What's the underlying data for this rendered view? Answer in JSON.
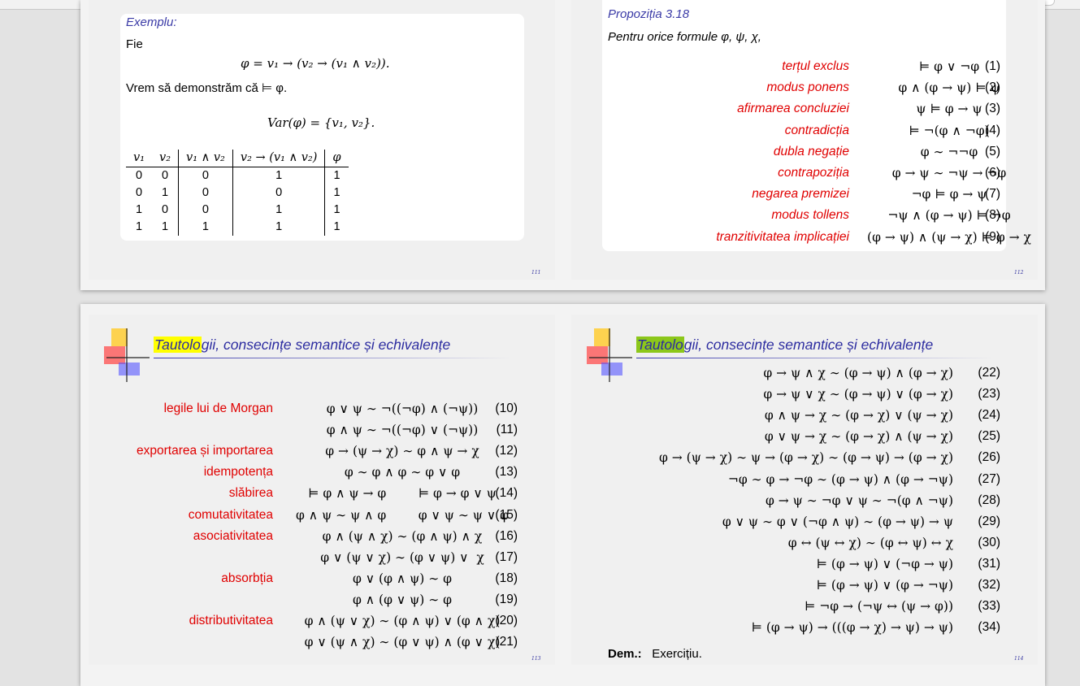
{
  "slide111": {
    "page": "111",
    "block_title": "Exemplu:",
    "fie": "Fie",
    "formula": "φ = v₁ → (v₂ → (v₁ ∧ v₂)).",
    "vrem": "Vrem să demonstrăm că ⊨ φ.",
    "var": "Var(φ) = {v₁, v₂}.",
    "table": {
      "headers": [
        "v₁",
        "v₂",
        "v₁ ∧ v₂",
        "v₂ → (v₁ ∧ v₂)",
        "φ"
      ],
      "rows": [
        [
          "0",
          "0",
          "0",
          "1",
          "1"
        ],
        [
          "0",
          "1",
          "0",
          "0",
          "1"
        ],
        [
          "1",
          "0",
          "0",
          "1",
          "1"
        ],
        [
          "1",
          "1",
          "1",
          "1",
          "1"
        ]
      ]
    }
  },
  "slide112": {
    "page": "112",
    "title": "Propoziția 3.18",
    "intro": "Pentru orice formule φ, ψ, χ,",
    "rows": [
      {
        "label": "terțul exclus",
        "formula": "⊨ φ ∨ ¬φ",
        "num": "(1)"
      },
      {
        "label": "modus ponens",
        "formula": "φ ∧ (φ → ψ) ⊨ ψ",
        "num": "(2)"
      },
      {
        "label": "afirmarea concluziei",
        "formula": "ψ ⊨ φ → ψ",
        "num": "(3)"
      },
      {
        "label": "contradicția",
        "formula": "⊨ ¬(φ ∧ ¬φ)",
        "num": "(4)"
      },
      {
        "label": "dubla negație",
        "formula": "φ ∼ ¬¬φ",
        "num": "(5)"
      },
      {
        "label": "contrapoziția",
        "formula": "φ → ψ ∼ ¬ψ → ¬φ",
        "num": "(6)"
      },
      {
        "label": "negarea premizei",
        "formula": "¬φ ⊨ φ → ψ",
        "num": "(7)"
      },
      {
        "label": "modus tollens",
        "formula": "¬ψ ∧ (φ → ψ) ⊨ ¬φ",
        "num": "(8)"
      },
      {
        "label": "tranzitivitatea implicației",
        "formula": "(φ → ψ) ∧ (ψ → χ) ⊨ φ → χ",
        "num": "(9)"
      }
    ]
  },
  "slide113": {
    "page": "113",
    "title_highlight": "Tautolo",
    "title_rest": "gii, consecințe semantice și echivalențe",
    "highlight_color": "#ffff00",
    "rows": [
      {
        "label": "legile lui de Morgan",
        "formula": "φ ∨ ψ ∼ ¬((¬φ) ∧ (¬ψ))",
        "num": "(10)"
      },
      {
        "label": "",
        "formula": "φ ∧ ψ ∼ ¬((¬φ) ∨ (¬ψ))",
        "num": "(11)"
      },
      {
        "label": "exportarea și importarea",
        "formula": "φ → (ψ → χ) ∼ φ ∧ ψ → χ",
        "num": "(12)"
      },
      {
        "label": "idempotența",
        "formula": "φ ∼ φ ∧ φ ∼ φ ∨ φ",
        "num": "(13)"
      },
      {
        "label": "slăbirea",
        "formula": "⊨ φ ∧ ψ → φ        ⊨ φ → φ ∨ ψ",
        "num": "(14)"
      },
      {
        "label": "comutativitatea",
        "formula": "φ ∧ ψ ∼ ψ ∧ φ        φ ∨ ψ ∼ ψ ∨ φ",
        "num": "(15)"
      },
      {
        "label": "asociativitatea",
        "formula": "φ ∧ (ψ ∧ χ) ∼ (φ ∧ ψ) ∧ χ",
        "num": "(16)"
      },
      {
        "label": "",
        "formula": "φ ∨ (ψ ∨ χ) ∼ (φ ∨ ψ) ∨  χ",
        "num": "(17)"
      },
      {
        "label": "absorbția",
        "formula": "φ ∨ (φ ∧ ψ) ∼ φ",
        "num": "(18)"
      },
      {
        "label": "",
        "formula": "φ ∧ (φ ∨ ψ) ∼ φ",
        "num": "(19)"
      },
      {
        "label": "distributivitatea",
        "formula": "φ ∧ (ψ ∨ χ) ∼ (φ ∧ ψ) ∨ (φ ∧ χ)",
        "num": "(20)"
      },
      {
        "label": "",
        "formula": "φ ∨ (ψ ∧ χ) ∼ (φ ∨ ψ) ∧ (φ ∨ χ)",
        "num": "(21)"
      }
    ]
  },
  "slide114": {
    "page": "114",
    "title_highlight": "Tautolo",
    "title_rest": "gii, consecințe semantice și echivalențe",
    "highlight_color": "#8cc71a",
    "rows": [
      {
        "formula": "φ → ψ ∧ χ ∼ (φ → ψ) ∧ (φ → χ)",
        "num": "(22)"
      },
      {
        "formula": "φ → ψ ∨ χ ∼ (φ → ψ) ∨ (φ → χ)",
        "num": "(23)"
      },
      {
        "formula": "φ ∧ ψ → χ ∼ (φ → χ) ∨ (ψ → χ)",
        "num": "(24)"
      },
      {
        "formula": "φ ∨ ψ → χ ∼ (φ → χ) ∧ (ψ → χ)",
        "num": "(25)"
      },
      {
        "formula": "φ → (ψ → χ) ∼ ψ → (φ → χ) ∼ (φ → ψ) → (φ → χ)",
        "num": "(26)"
      },
      {
        "formula": "¬φ ∼ φ → ¬φ ∼ (φ → ψ) ∧ (φ → ¬ψ)",
        "num": "(27)"
      },
      {
        "formula": "φ → ψ ∼ ¬φ ∨ ψ ∼ ¬(φ ∧ ¬ψ)",
        "num": "(28)"
      },
      {
        "formula": "φ ∨ ψ ∼ φ ∨ (¬φ ∧ ψ) ∼ (φ → ψ) → ψ",
        "num": "(29)"
      },
      {
        "formula": "φ ↔ (ψ ↔ χ) ∼ (φ ↔ ψ) ↔ χ",
        "num": "(30)"
      },
      {
        "formula": "⊨ (φ → ψ) ∨ (¬φ → ψ)",
        "num": "(31)"
      },
      {
        "formula": "⊨ (φ → ψ) ∨ (φ → ¬ψ)",
        "num": "(32)"
      },
      {
        "formula": "⊨ ¬φ → (¬ψ ↔ (ψ → φ))",
        "num": "(33)"
      },
      {
        "formula": "⊨ (φ → ψ) → (((φ → χ) → ψ) → ψ)",
        "num": "(34)"
      }
    ],
    "dem_label": "Dem.:",
    "dem_text": "Exercițiu."
  }
}
